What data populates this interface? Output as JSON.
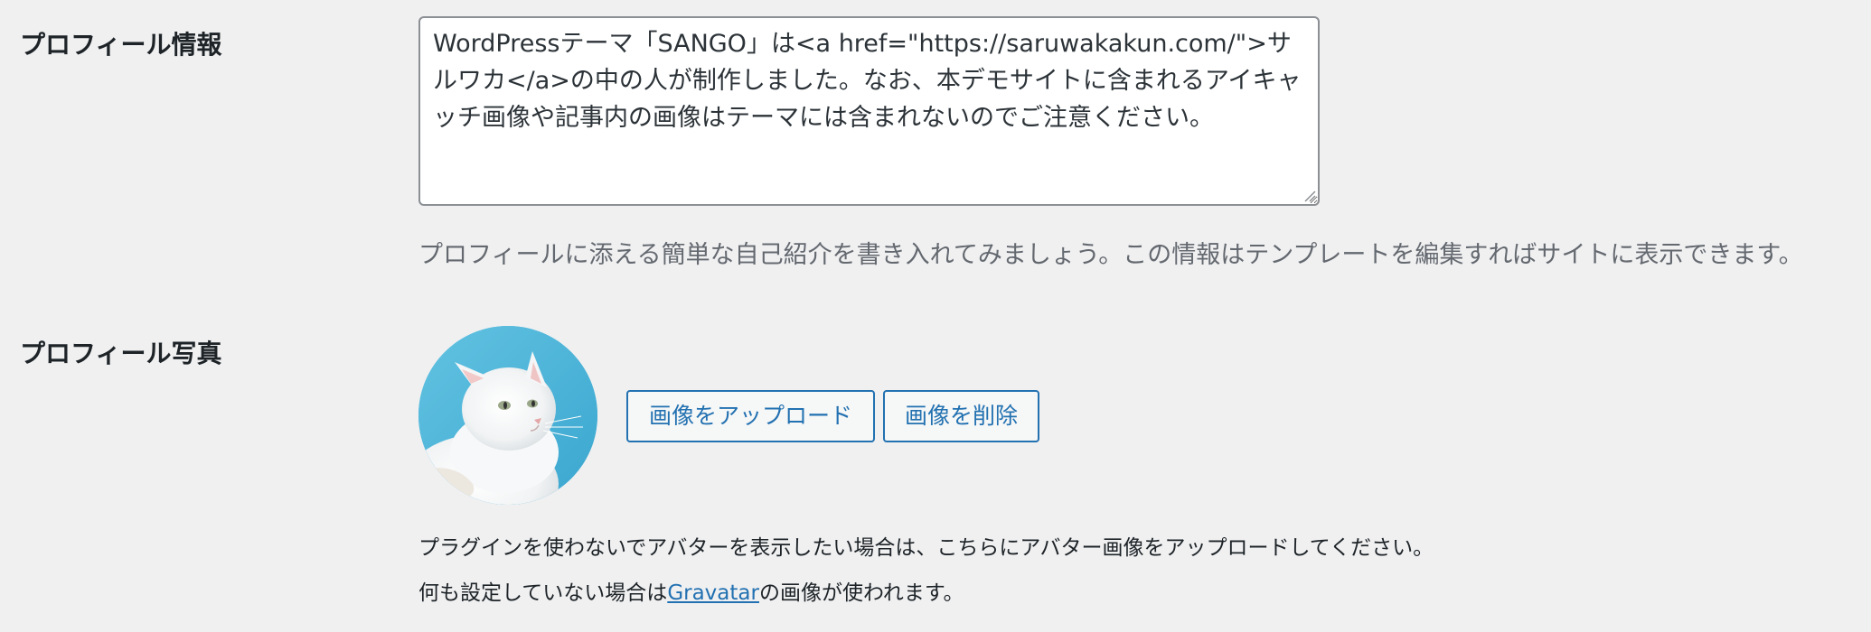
{
  "bio": {
    "label": "プロフィール情報",
    "value": "WordPressテーマ「SANGO」は<a href=\"https://saruwakakun.com/\">サルワカ</a>の中の人が制作しました。なお、本デモサイトに含まれるアイキャッチ画像や記事内の画像はテーマには含まれないのでご注意ください。",
    "help": "プロフィールに添える簡単な自己紹介を書き入れてみましょう。この情報はテンプレートを編集すればサイトに表示できます。"
  },
  "photo": {
    "label": "プロフィール写真",
    "upload_label": "画像をアップロード",
    "remove_label": "画像を削除",
    "help_line_1": "プラグインを使わないでアバターを表示したい場合は、こちらにアバター画像をアップロードしてください。",
    "help_line_2_before": "何も設定していない場合は",
    "help_line_2_link": "Gravatar",
    "help_line_2_after": "の画像が使われます。"
  },
  "colors": {
    "background": "#f0f0f1",
    "accent": "#2271b1",
    "muted_text": "#646970"
  }
}
